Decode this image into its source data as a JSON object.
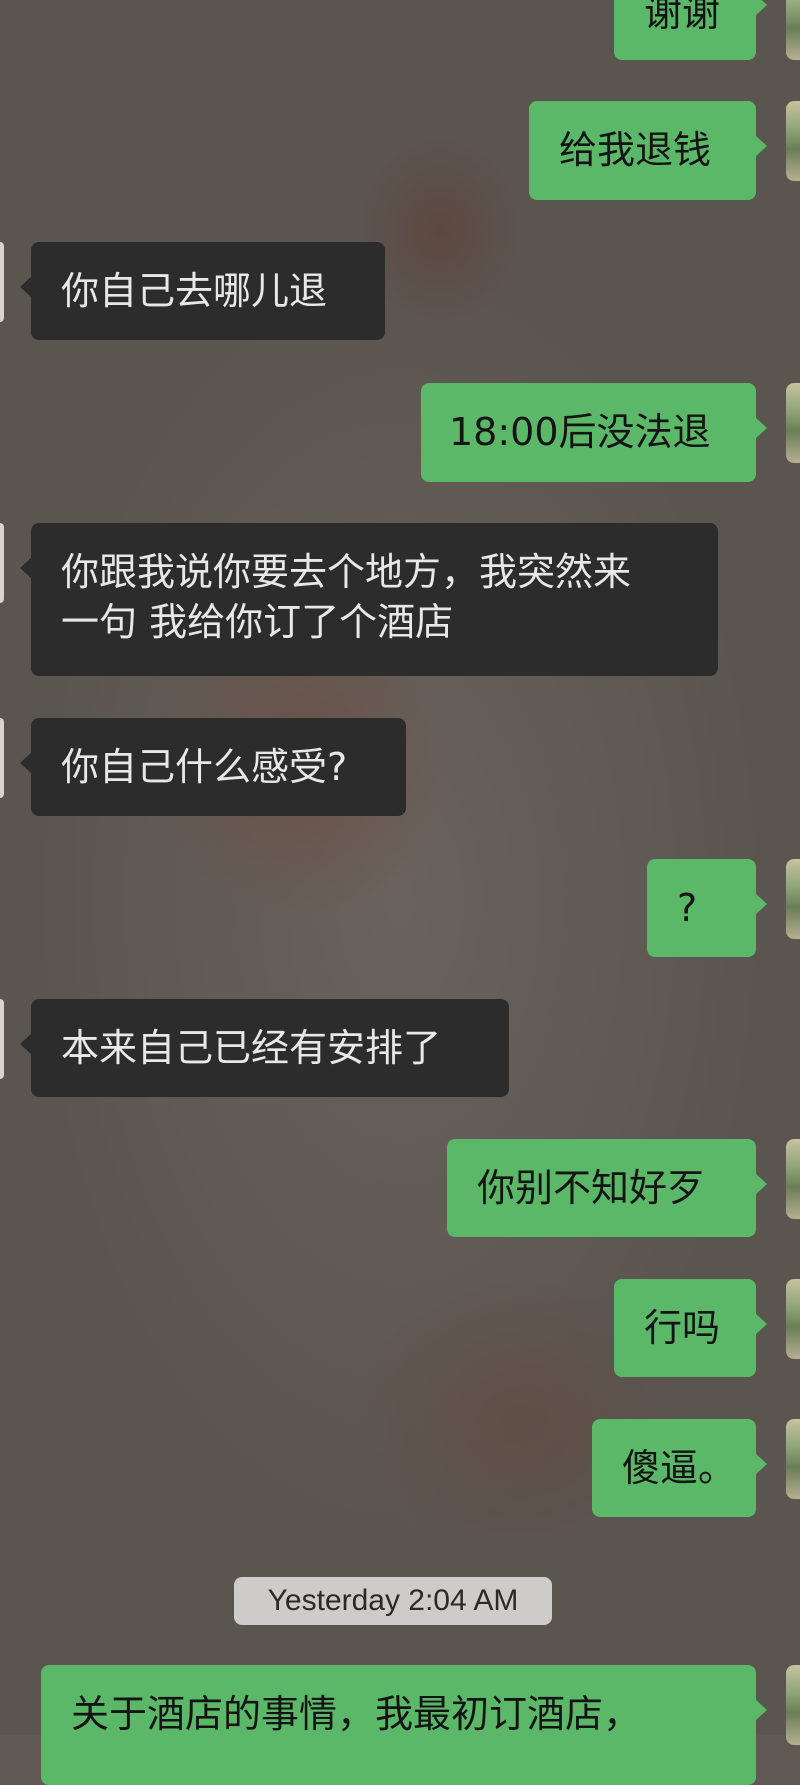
{
  "messages": [
    {
      "side": "me",
      "text": "谢谢"
    },
    {
      "side": "me",
      "text": "给我退钱"
    },
    {
      "side": "them",
      "text": "你自己去哪儿退"
    },
    {
      "side": "me",
      "text": "18:00后没法退"
    },
    {
      "side": "them",
      "line1": "你跟我说你要去个地方，我突然来",
      "line2": "一句 我给你订了个酒店"
    },
    {
      "side": "them",
      "text": "你自己什么感受?"
    },
    {
      "side": "me",
      "text": "?"
    },
    {
      "side": "them",
      "text": "本来自己已经有安排了"
    },
    {
      "side": "me",
      "text": "你别不知好歹"
    },
    {
      "side": "me",
      "text": "行吗"
    },
    {
      "side": "me",
      "text": "傻逼。"
    },
    {
      "side": "me",
      "text": "关于酒店的事情，我最初订酒店，"
    }
  ],
  "timestamp": "Yesterday 2:04 AM",
  "colors": {
    "me_bubble": "#5cb869",
    "them_bubble": "#2c2c2c",
    "background": "#5f5853"
  }
}
